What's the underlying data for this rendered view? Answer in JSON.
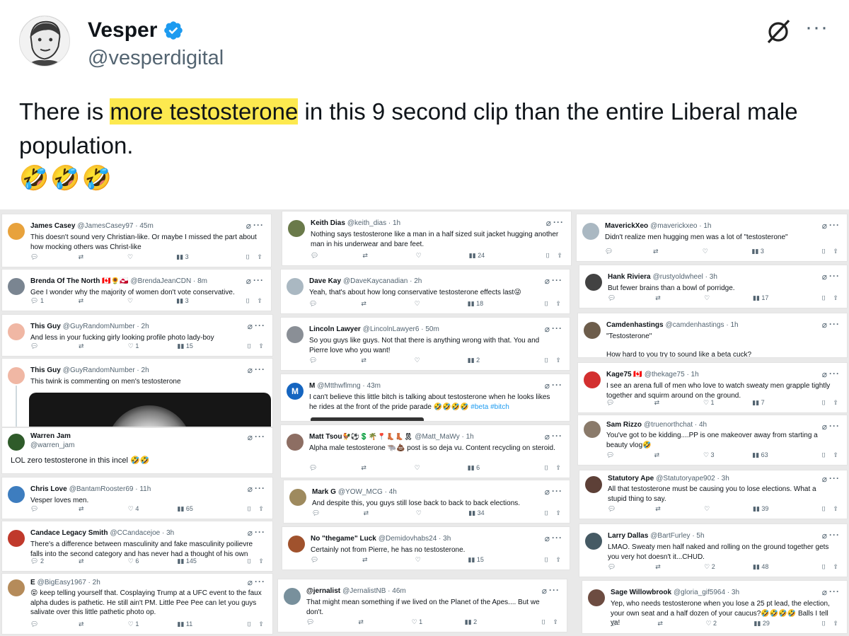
{
  "tweet": {
    "name": "Vesper",
    "handle": "@vesperdigital",
    "text_before": "There is ",
    "text_highlight": "more testosterone",
    "text_after": " in this 9 second clip than the entire Liberal male population.",
    "emoji": "🤣🤣🤣",
    "more_icon": "···",
    "colors": {
      "highlight": "#fde94f",
      "verified": "#1d9bf0"
    }
  },
  "replies": [
    {
      "name": "James Casey",
      "handle": "@JamesCasey97 · 45m",
      "text": "This doesn't sound very Christian-like. Or maybe I missed the part about how mocking others was Christ-like",
      "replies": "",
      "retweets": "",
      "likes": "",
      "views": "3",
      "avatar": "#e8a23c"
    },
    {
      "name": "Brenda Of The North 🇨🇦🌻🇬🇱",
      "handle": "@BrendaJeanCDN · 8m",
      "text": "Gee I wonder why the majority of women don't vote conservative.",
      "replies": "1",
      "retweets": "",
      "likes": "",
      "views": "3",
      "avatar": "#7a8591"
    },
    {
      "name": "This Guy",
      "handle": "@GuyRandomNumber · 2h",
      "text": "And less in your fucking girly looking profile photo lady-boy",
      "replies": "",
      "retweets": "",
      "likes": "1",
      "views": "15",
      "avatar": "#f0b7a4"
    },
    {
      "name": "This Guy",
      "handle": "@GuyRandomNumber · 2h",
      "text": "This twink is commenting on men's testosterone",
      "avatar": "#f0b7a4"
    },
    {
      "name": "Warren Jam",
      "handle": "@warren_jam",
      "text": "LOL zero testosterone in this incel 🤣🤣",
      "avatar": "#2f5b2a"
    },
    {
      "name": "Chris Love",
      "handle": "@BantamRooster69 · 11h",
      "text": "Vesper loves men.",
      "replies": "",
      "retweets": "",
      "likes": "4",
      "views": "65",
      "avatar": "#3d7dbf"
    },
    {
      "name": "Candace Legacy Smith",
      "handle": "@CCandacejoe · 3h",
      "text": "There's a difference between masculinity and fake masculinity poilievre falls into the second category and has never had a thought of his own",
      "replies": "2",
      "retweets": "",
      "likes": "6",
      "views": "145",
      "avatar": "#c0392b"
    },
    {
      "name": "E",
      "handle": "@BigEasy1967 · 2h",
      "text": "😝 keep telling yourself that. Cosplaying Trump at a UFC event to the faux alpha dudes is pathetic. He still ain't PM. Little Pee Pee can let you guys salivate over this little pathetic photo op.",
      "replies": "",
      "retweets": "",
      "likes": "1",
      "views": "11",
      "avatar": "#b58b5a"
    },
    {
      "name": "Keith Dias",
      "handle": "@keith_dias · 1h",
      "text": "Nothing says testosterone like a man in a half sized suit jacket hugging another man in his underwear and bare feet.",
      "replies": "",
      "retweets": "",
      "likes": "",
      "views": "24",
      "avatar": "#6a7a4a"
    },
    {
      "name": "Dave Kay",
      "handle": "@DaveKaycanadian · 2h",
      "text": "Yeah, that's about how long conservative testosterone effects last😜",
      "replies": "",
      "retweets": "",
      "likes": "",
      "views": "18",
      "avatar": "#aab8c2"
    },
    {
      "name": "Lincoln Lawyer",
      "handle": "@LincolnLawyer6 · 50m",
      "text": "So you guys like guys. Not that there is anything wrong with that. You and Pierre love who you want!",
      "replies": "",
      "retweets": "",
      "likes": "",
      "views": "2",
      "avatar": "#8a8f96"
    },
    {
      "name": "M",
      "handle": "@Mtthwflmng · 43m",
      "text": "I can't believe this little bitch is talking about testosterone when he looks likes he rides at the front of the pride parade 🤣🤣🤣🤣",
      "tags": "#beta #bitch",
      "avatar": "#1565c0",
      "initial": "M"
    },
    {
      "name": "Matt Tsou🐓⚽💲🌴📍👢👢🎗",
      "handle": "@Matt_MaWy · 1h",
      "text": "Alpha male testosterone 🐃💩 post is so deja vu. Content recycling on steroid.",
      "replies": "",
      "retweets": "",
      "likes": "",
      "views": "6",
      "avatar": "#8d6e63"
    },
    {
      "name": "Mark G",
      "handle": "@YOW_MCG · 4h",
      "text": "And despite this, you guys still lose back to back to back elections.",
      "replies": "",
      "retweets": "",
      "likes": "",
      "views": "34",
      "avatar": "#9e8a5e"
    },
    {
      "name": "No \"thegame\" Luck",
      "handle": "@Demidovhabs24 · 3h",
      "text": "Certainly not from Pierre, he has no testosterone.",
      "replies": "",
      "retweets": "",
      "likes": "",
      "views": "15",
      "avatar": "#a0522d"
    },
    {
      "name": "@jernalist",
      "handle": "@JernalistNB · 46m",
      "text": "That might mean something if we lived on the Planet of the Apes.... But we don't.",
      "replies": "",
      "retweets": "",
      "likes": "1",
      "views": "2",
      "avatar": "#78909c"
    },
    {
      "name": "MaverickXeo",
      "handle": "@maverickxeo · 1h",
      "text": "Didn't realize men hugging men was a lot of \"testosterone\"",
      "replies": "",
      "retweets": "",
      "likes": "",
      "views": "3",
      "avatar": "#aab8c2"
    },
    {
      "name": "Hank Riviera",
      "handle": "@rustyoldwheel · 3h",
      "text": "But fewer brains than a bowl of porridge.",
      "replies": "",
      "retweets": "",
      "likes": "",
      "views": "17",
      "avatar": "#424242"
    },
    {
      "name": "Camdenhastings",
      "handle": "@camdenhastings · 1h",
      "text": "\"Testosterone\"",
      "text2": "How hard to you try to sound like a beta cuck?",
      "avatar": "#6d5d4b"
    },
    {
      "name": "Kage75 🇨🇦",
      "handle": "@thekage75 · 1h",
      "text": "I see an arena full of men who love to watch sweaty men grapple tightly together and squirm around on the ground.",
      "replies": "",
      "retweets": "",
      "likes": "1",
      "views": "7",
      "avatar": "#d32f2f"
    },
    {
      "name": "Sam Rizzo",
      "handle": "@truenorthchat · 4h",
      "text": "You've got to be kidding....PP is one makeover away from starting a beauty vlog🤣",
      "replies": "",
      "retweets": "",
      "likes": "3",
      "views": "63",
      "avatar": "#8a7a6a"
    },
    {
      "name": "Statutory Ape",
      "handle": "@Statutoryape902 · 3h",
      "text": "All that testosterone must be causing you to lose elections. What a stupid thing to say.",
      "replies": "",
      "retweets": "",
      "likes": "",
      "views": "39",
      "avatar": "#5d4037"
    },
    {
      "name": "Larry Dallas",
      "handle": "@BartFurley · 5h",
      "text": "LMAO. Sweaty men half naked and rolling on the ground together gets you very hot doesn't it...CHUD.",
      "replies": "",
      "retweets": "",
      "likes": "2",
      "views": "48",
      "avatar": "#455a64"
    },
    {
      "name": "Sage Willowbrook",
      "handle": "@gloria_gif5964 · 3h",
      "text": "Yep, who needs testosterone when you lose a 25 pt lead, the election, your own seat and a half dozen of your caucus?🤣🤣🤣🤣 Balls I tell ya!",
      "replies": "",
      "retweets": "",
      "likes": "2",
      "views": "29",
      "avatar": "#6d4c41"
    }
  ],
  "icons": {
    "reply": "reply-icon",
    "retweet": "retweet-icon",
    "like": "heart-icon",
    "views": "views-icon",
    "bookmark": "bookmark-icon",
    "share": "share-icon",
    "grok": "grok-icon",
    "more": "more-icon"
  }
}
